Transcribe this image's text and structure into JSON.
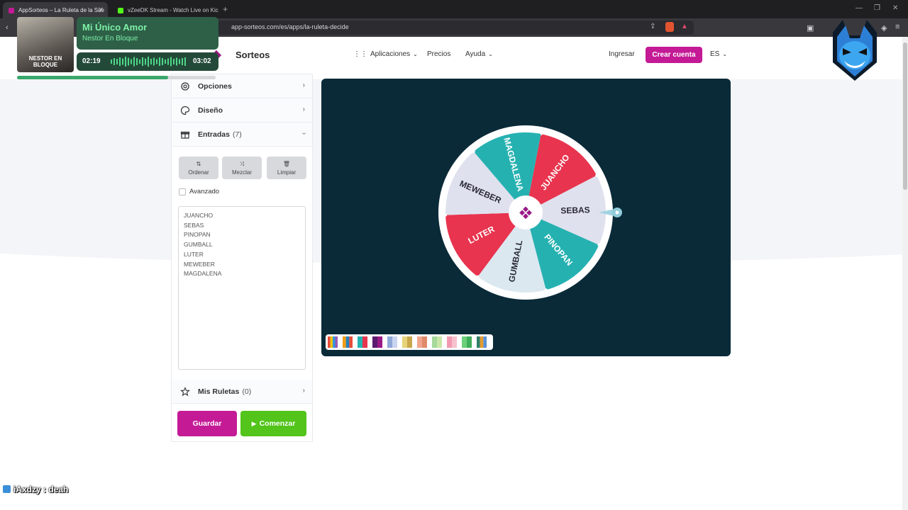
{
  "browser": {
    "tabs": [
      {
        "title": "AppSorteos – La Ruleta de la Sue",
        "active": true
      },
      {
        "title": "vZeeDK Stream - Watch Live on Kick",
        "active": false
      }
    ],
    "url": "app-sorteos.com/es/apps/la-ruleta-decide"
  },
  "header": {
    "brand": "Sorteos",
    "nav": {
      "apps": "Aplicaciones",
      "pricing": "Precios",
      "help": "Ayuda"
    },
    "login": "Ingresar",
    "signup": "Crear cuenta",
    "lang": "ES"
  },
  "sidebar": {
    "options": "Opciones",
    "design": "Diseño",
    "entries_label": "Entradas",
    "entries_count": "(7)",
    "tools": {
      "sort": "Ordenar",
      "shuffle": "Mezclar",
      "clear": "Limpiar"
    },
    "advanced": "Avanzado",
    "entries": [
      "JUANCHO",
      "SEBAS",
      "PINOPAN",
      "GUMBALL",
      "LUTER",
      "MEWEBER",
      "MAGDALENA"
    ],
    "my_wheels_label": "Mis Ruletas",
    "my_wheels_count": "(0)",
    "save": "Guardar",
    "start": "Comenzar"
  },
  "wheel": {
    "segments": [
      {
        "label": "JUANCHO",
        "color": "#e8344e"
      },
      {
        "label": "SEBAS",
        "color": "#dfe1ee"
      },
      {
        "label": "PINOPAN",
        "color": "#26b1b1"
      },
      {
        "label": "GUMBALL",
        "color": "#dbe8f0"
      },
      {
        "label": "LUTER",
        "color": "#e8344e"
      },
      {
        "label": "MEWEBER",
        "color": "#dfe1ee"
      },
      {
        "label": "MAGDALENA",
        "color": "#26b1b1"
      }
    ],
    "center_color": "#9a1a86",
    "background": "#0a2a38"
  },
  "music": {
    "title": "Mi Único Amor",
    "artist": "Nestor En Bloque",
    "elapsed": "02:19",
    "duration": "03:02",
    "progress": 0.76,
    "cover_text": "NESTOR EN BLOQUE"
  },
  "chat": {
    "message": "iAxdzy : deah"
  }
}
